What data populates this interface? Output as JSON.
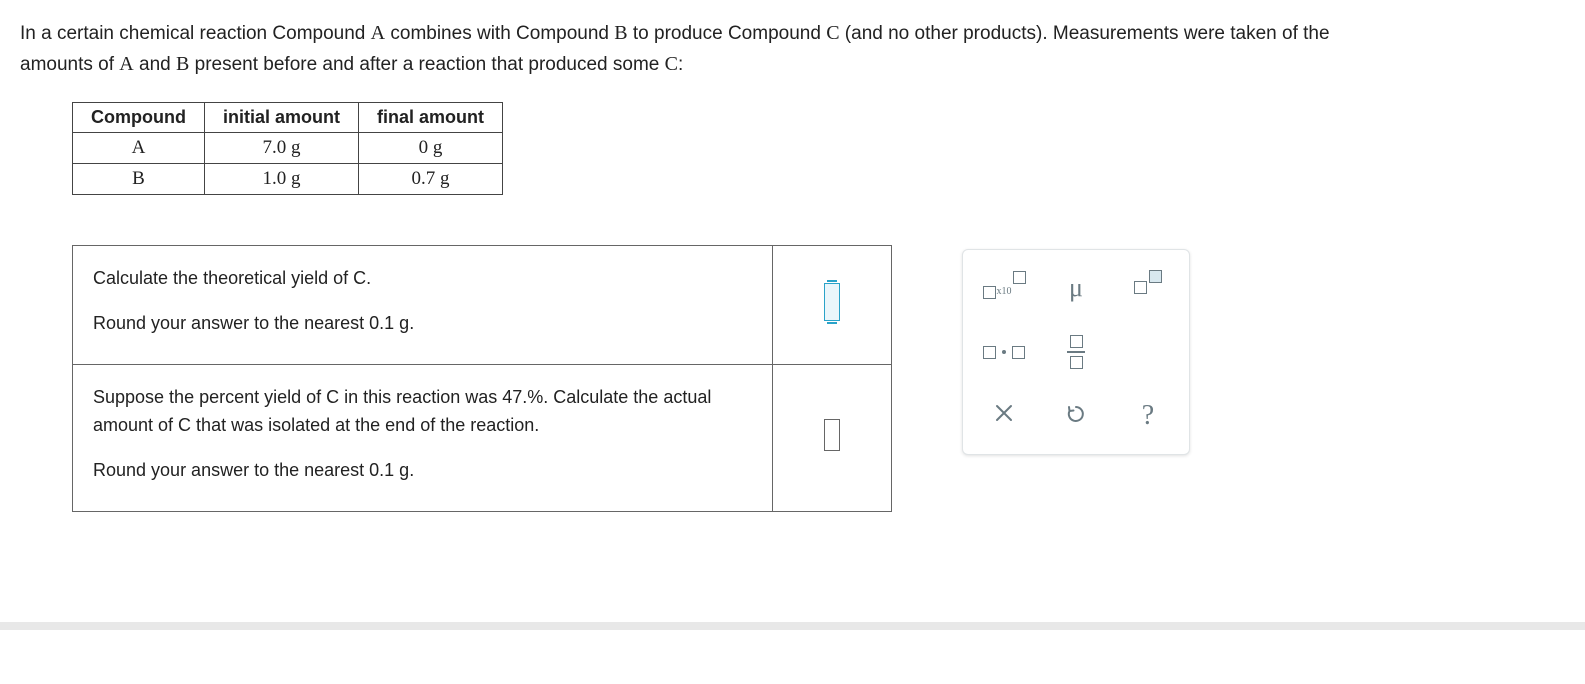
{
  "intro": {
    "line1_pre": "In a certain chemical reaction Compound ",
    "A": "A",
    "line1_mid1": " combines with Compound ",
    "B": "B",
    "line1_mid2": " to produce Compound ",
    "C": "C",
    "line1_post": " (and no other products). Measurements were taken of the",
    "line2_pre": "amounts of ",
    "line2_mid": " and ",
    "line2_post": " present before and after a reaction that produced some ",
    "line2_end": ":"
  },
  "table": {
    "headers": {
      "compound": "Compound",
      "initial": "initial amount",
      "final": "final amount"
    },
    "rows": [
      {
        "compound": "A",
        "initial": "7.0 g",
        "final": "0 g"
      },
      {
        "compound": "B",
        "initial": "1.0 g",
        "final": "0.7 g"
      }
    ]
  },
  "questions": [
    {
      "line1": "Calculate the theoretical yield of C.",
      "line2": "Round your answer to the nearest 0.1 g."
    },
    {
      "line1": "Suppose the percent yield of C in this reaction was 47.%. Calculate the actual amount of C that was isolated at the end of the reaction.",
      "line2": "Round your answer to the nearest 0.1 g."
    }
  ],
  "toolbox": {
    "sci": "x10",
    "mu": "μ",
    "help": "?"
  }
}
